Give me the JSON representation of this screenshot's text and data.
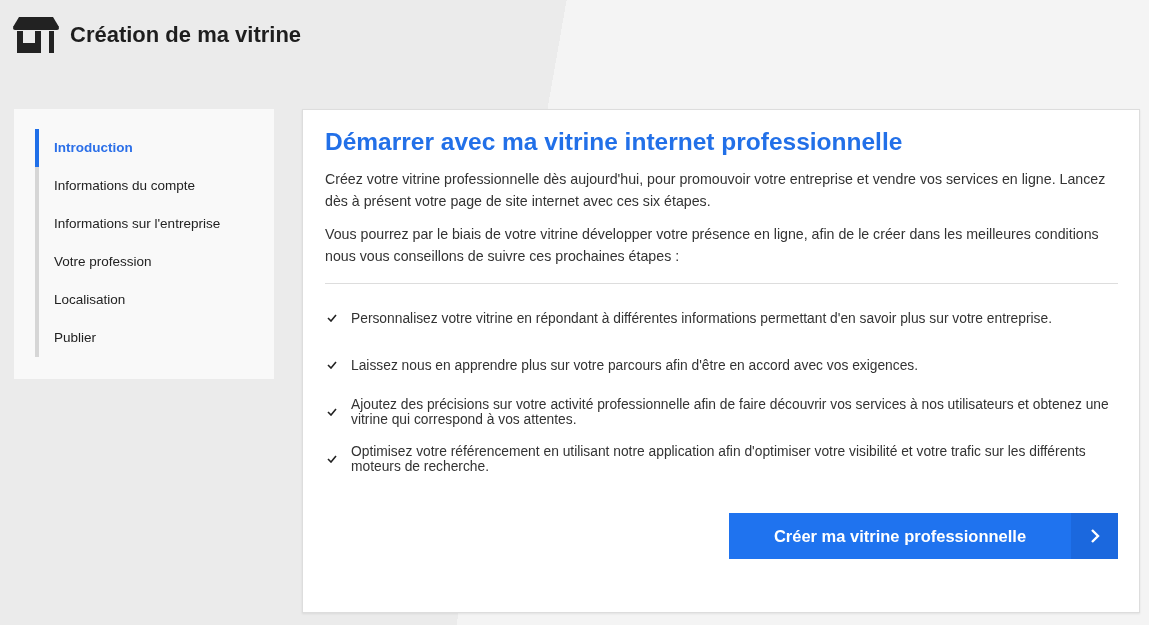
{
  "header": {
    "title": "Création de ma vitrine"
  },
  "steps": [
    {
      "label": "Introduction",
      "selected": true
    },
    {
      "label": "Informations du compte",
      "selected": false
    },
    {
      "label": "Informations sur l'entreprise",
      "selected": false
    },
    {
      "label": "Votre profession",
      "selected": false
    },
    {
      "label": "Localisation",
      "selected": false
    },
    {
      "label": "Publier",
      "selected": false
    }
  ],
  "main": {
    "title": "Démarrer avec ma vitrine internet professionnelle",
    "paragraphs": [
      "Créez votre vitrine professionnelle dès aujourd'hui, pour promouvoir votre entreprise et vendre vos services en ligne. Lancez dès à présent votre page de site internet avec ces six étapes.",
      "Vous pourrez par le biais de votre vitrine développer votre présence en ligne, afin de le créer dans les meilleures conditions nous vous conseillons de suivre ces prochaines étapes :"
    ],
    "checklist": [
      "Personnalisez votre vitrine en répondant à différentes informations permettant d'en savoir plus sur votre entreprise.",
      "Laissez nous en apprendre plus sur votre parcours afin d'être en accord avec vos exigences.",
      "Ajoutez des précisions sur votre activité professionnelle afin de faire découvrir vos services à nos utilisateurs et obtenez une vitrine qui correspond à vos attentes.",
      "Optimisez votre référencement en utilisant notre application afin d'optimiser votre visibilité et votre trafic sur les différents moteurs de recherche."
    ],
    "button": "Créer ma vitrine professionnelle"
  }
}
